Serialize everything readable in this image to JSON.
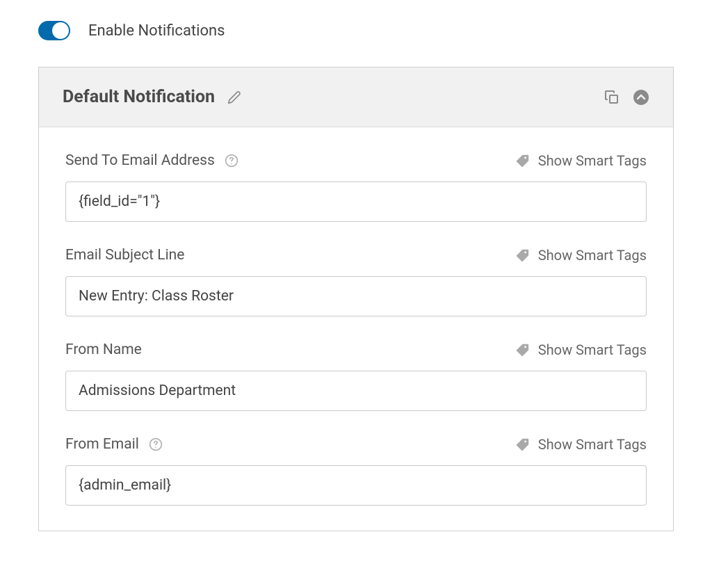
{
  "toggle": {
    "label": "Enable Notifications"
  },
  "panel": {
    "title": "Default Notification"
  },
  "smart_tags_label": "Show Smart Tags",
  "fields": {
    "send_to": {
      "label": "Send To Email Address",
      "value": "{field_id=\"1\"}"
    },
    "subject": {
      "label": "Email Subject Line",
      "value": "New Entry: Class Roster"
    },
    "from_name": {
      "label": "From Name",
      "value": "Admissions Department"
    },
    "from_email": {
      "label": "From Email",
      "value": "{admin_email}"
    }
  }
}
